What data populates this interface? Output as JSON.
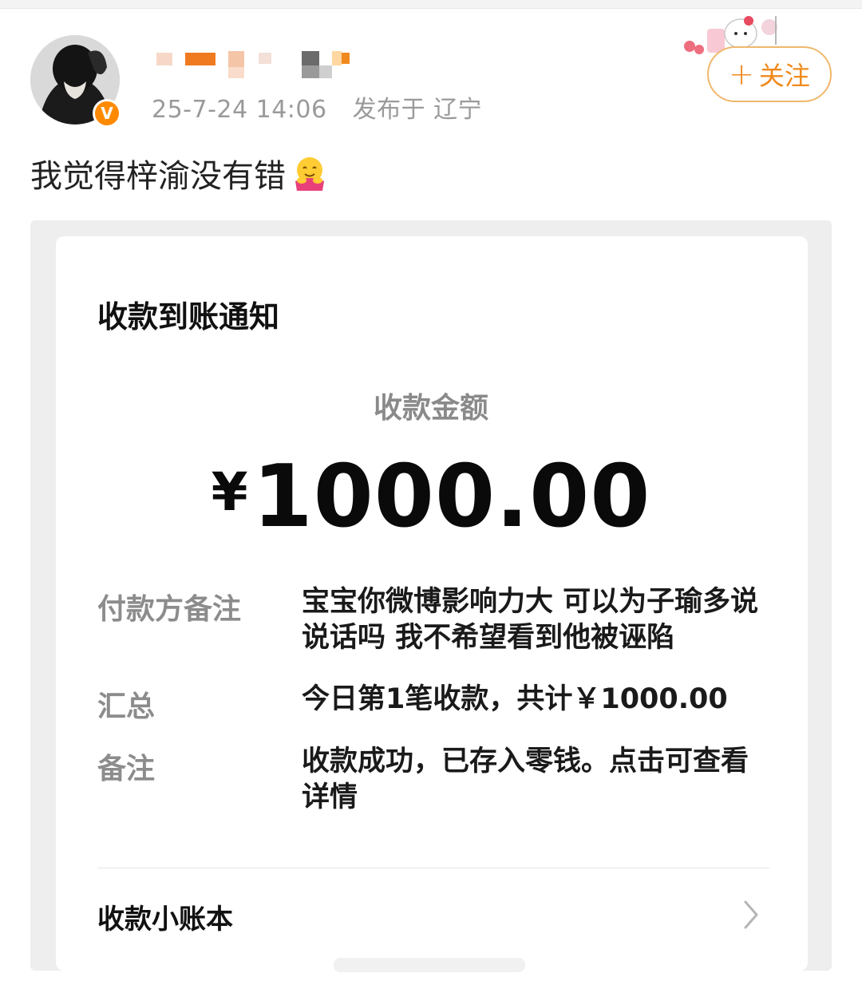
{
  "post": {
    "timestamp": "25-7-24 14:06",
    "location_prefix": "发布于",
    "location": "辽宁",
    "follow_label": "关注",
    "text": "我觉得梓渝没有错"
  },
  "icons": {
    "avatar": "avatar",
    "verified": "verified-v-badge",
    "follow_plus": "plus-icon",
    "emoji": "hug-emoji",
    "chevron": "chevron-right-icon",
    "decoration": "hello-kitty-sticker"
  },
  "badge": {
    "letter": "V"
  },
  "card": {
    "title": "收款到账通知",
    "amount_label": "收款金额",
    "currency": "¥",
    "amount": "1000.00",
    "rows": [
      {
        "label": "付款方备注",
        "value": "宝宝你微博影响力大 可以为子瑜多说说话吗 我不希望看到他被诬陷"
      },
      {
        "label": "汇总",
        "value": "今日第1笔收款，共计￥1000.00"
      },
      {
        "label": "备注",
        "value": "收款成功，已存入零钱。点击可查看详情"
      }
    ],
    "ledger_label": "收款小账本"
  },
  "colors": {
    "accent_orange": "#f08a1c",
    "badge_orange": "#ff8a00"
  }
}
